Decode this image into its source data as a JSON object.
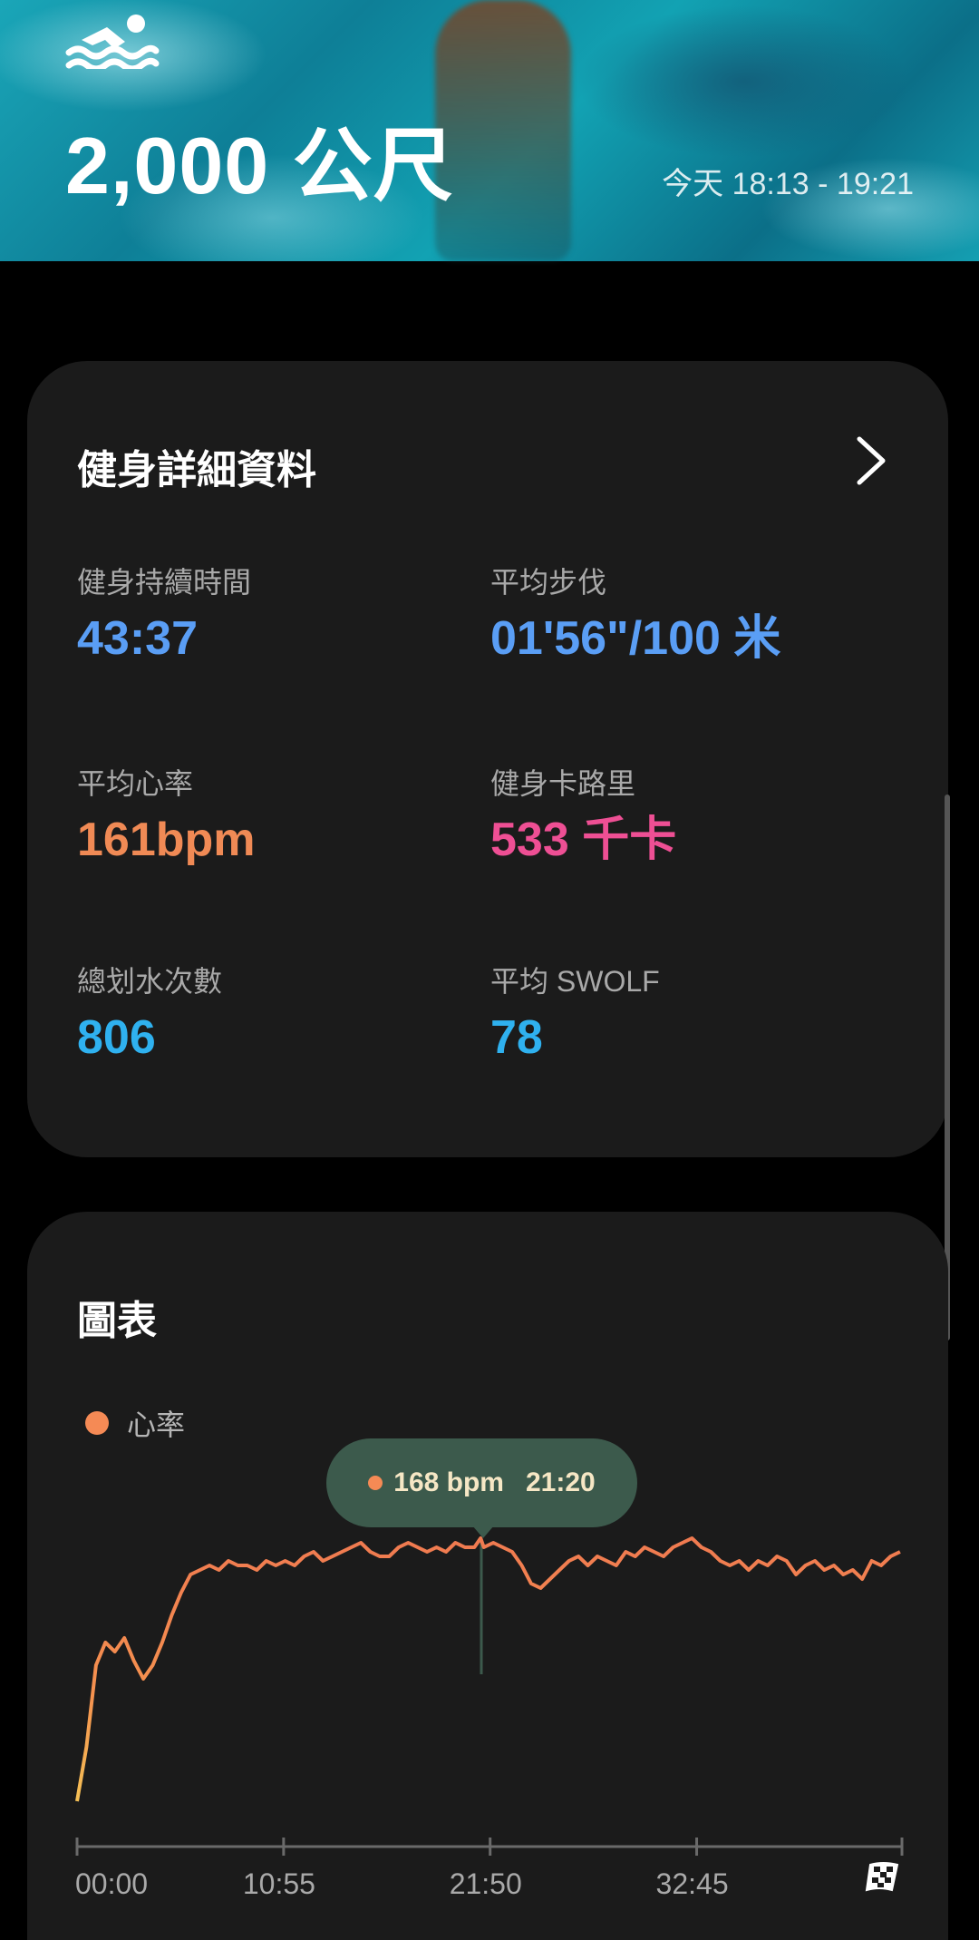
{
  "header": {
    "distance": "2,000 公尺",
    "time_range": "今天 18:13 - 19:21",
    "activity_icon": "swimming-icon"
  },
  "details_card": {
    "title": "健身詳細資料",
    "more_icon": "chevron-right-icon",
    "stats": [
      {
        "label": "健身持續時間",
        "value": "43:37",
        "color": "#5a9ef5"
      },
      {
        "label": "平均步伐",
        "value": "01'56\"/100 米",
        "color": "#5a9ef5"
      },
      {
        "label": "平均心率",
        "value": "161bpm",
        "color": "#f08a55"
      },
      {
        "label": "健身卡路里",
        "value": "533 千卡",
        "color": "#ee4f94"
      },
      {
        "label": "總划水次數",
        "value": "806",
        "color": "#2fb1ef"
      },
      {
        "label": "平均 SWOLF",
        "value": "78",
        "color": "#2fb1ef"
      }
    ]
  },
  "chart_card": {
    "title": "圖表",
    "legend": "心率",
    "tooltip": {
      "value": "168 bpm",
      "time": "21:20"
    },
    "end_icon": "checkered-flag-icon"
  },
  "chart_data": {
    "type": "line",
    "x_ticks": [
      "00:00",
      "10:55",
      "21:50",
      "32:45"
    ],
    "series": [
      {
        "name": "心率",
        "x_minutes": [
          0,
          0.5,
          1,
          1.5,
          2,
          2.5,
          3,
          3.5,
          4,
          4.5,
          5,
          5.5,
          6,
          6.5,
          7,
          7.5,
          8,
          8.5,
          9,
          9.5,
          10,
          10.5,
          11,
          11.5,
          12,
          12.5,
          13,
          13.5,
          14,
          14.5,
          15,
          15.5,
          16,
          16.5,
          17,
          17.5,
          18,
          18.5,
          19,
          19.5,
          20,
          20.5,
          21,
          21.33,
          21.5,
          22,
          22.5,
          23,
          23.5,
          24,
          24.5,
          25,
          25.5,
          26,
          26.5,
          27,
          27.5,
          28,
          28.5,
          29,
          29.5,
          30,
          30.5,
          31,
          31.5,
          32,
          32.5,
          33,
          33.5,
          34,
          34.5,
          35,
          35.5,
          36,
          36.5,
          37,
          37.5,
          38,
          38.5,
          39,
          39.5,
          40,
          40.5,
          41,
          41.5,
          42,
          42.5,
          43,
          43.5
        ],
        "values": [
          110,
          122,
          140,
          145,
          143,
          146,
          141,
          137,
          140,
          145,
          151,
          156,
          160,
          161,
          162,
          161,
          163,
          162,
          162,
          161,
          163,
          162,
          163,
          162,
          164,
          165,
          163,
          164,
          165,
          166,
          167,
          165,
          164,
          164,
          166,
          167,
          166,
          165,
          166,
          165,
          167,
          166,
          166,
          168,
          166,
          167,
          166,
          165,
          162,
          158,
          157,
          159,
          161,
          163,
          164,
          162,
          164,
          163,
          162,
          165,
          164,
          166,
          165,
          164,
          166,
          167,
          168,
          166,
          165,
          163,
          162,
          163,
          161,
          163,
          162,
          164,
          163,
          160,
          162,
          163,
          161,
          162,
          160,
          161,
          159,
          163,
          162,
          164,
          165
        ]
      }
    ],
    "ylim": [
      100,
      180
    ]
  }
}
